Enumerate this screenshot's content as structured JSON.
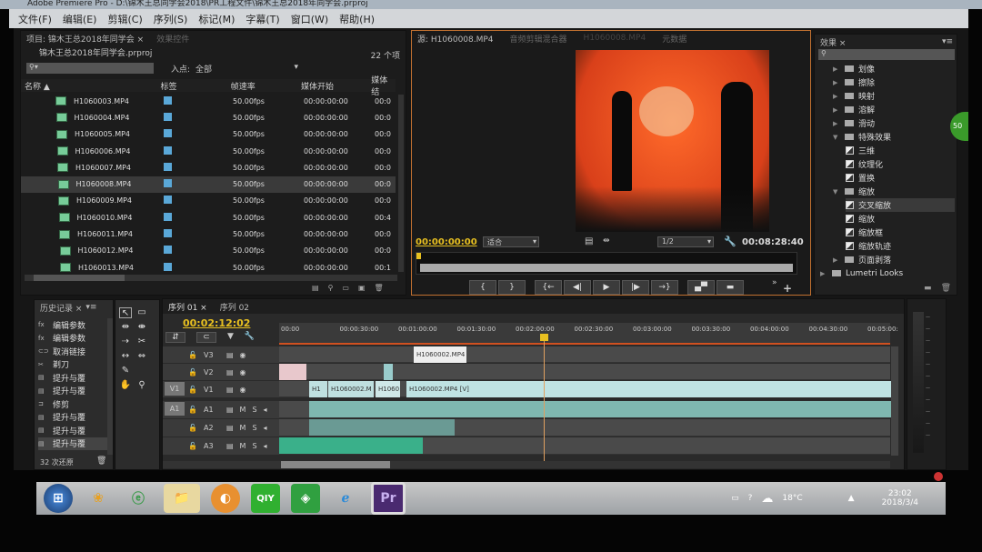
{
  "window": {
    "title": "Adobe Premiere Pro - D:\\锦木王总同学会2018\\PR工程文件\\锦木王总2018年同学会.prproj"
  },
  "menu": [
    "文件(F)",
    "编辑(E)",
    "剪辑(C)",
    "序列(S)",
    "标记(M)",
    "字幕(T)",
    "窗口(W)",
    "帮助(H)"
  ],
  "project": {
    "tab": "项目: 锦木王总2018年同学会 ×",
    "tab2": "效果控件",
    "file": "锦木王总2018年同学会.prproj",
    "count": "22 个项",
    "inpoint_label": "入点:",
    "inpoint_value": "全部",
    "columns": [
      "名称 ▲",
      "标签",
      "帧速率",
      "媒体开始",
      "媒体结"
    ],
    "rows": [
      {
        "name": "H1060003.MP4",
        "fps": "50.00fps",
        "start": "00:00:00:00",
        "end": "00:0"
      },
      {
        "name": "H1060004.MP4",
        "fps": "50.00fps",
        "start": "00:00:00:00",
        "end": "00:0"
      },
      {
        "name": "H1060005.MP4",
        "fps": "50.00fps",
        "start": "00:00:00:00",
        "end": "00:0"
      },
      {
        "name": "H1060006.MP4",
        "fps": "50.00fps",
        "start": "00:00:00:00",
        "end": "00:0"
      },
      {
        "name": "H1060007.MP4",
        "fps": "50.00fps",
        "start": "00:00:00:00",
        "end": "00:0"
      },
      {
        "name": "H1060008.MP4",
        "fps": "50.00fps",
        "start": "00:00:00:00",
        "end": "00:0"
      },
      {
        "name": "H1060009.MP4",
        "fps": "50.00fps",
        "start": "00:00:00:00",
        "end": "00:0"
      },
      {
        "name": "H1060010.MP4",
        "fps": "50.00fps",
        "start": "00:00:00:00",
        "end": "00:4"
      },
      {
        "name": "H1060011.MP4",
        "fps": "50.00fps",
        "start": "00:00:00:00",
        "end": "00:0"
      },
      {
        "name": "H1060012.MP4",
        "fps": "50.00fps",
        "start": "00:00:00:00",
        "end": "00:0"
      },
      {
        "name": "H1060013.MP4",
        "fps": "50.00fps",
        "start": "00:00:00:00",
        "end": "00:1"
      }
    ],
    "label_color": "#5aa8d8"
  },
  "source": {
    "tabs": [
      "源: H1060008.MP4",
      "音频剪辑混合器",
      "H1060008.MP4",
      "元数据"
    ],
    "timecode_in": "00:00:00:00",
    "fit": "适合",
    "resolution": "1/2",
    "duration": "00:08:28:40"
  },
  "effects": {
    "tab": "效果 ×",
    "items": [
      {
        "label": "划像",
        "type": "folder",
        "open": false,
        "indent": 0
      },
      {
        "label": "擦除",
        "type": "folder",
        "open": false,
        "indent": 0
      },
      {
        "label": "映射",
        "type": "folder",
        "open": false,
        "indent": 0
      },
      {
        "label": "溶解",
        "type": "folder",
        "open": false,
        "indent": 0
      },
      {
        "label": "滑动",
        "type": "folder",
        "open": false,
        "indent": 0
      },
      {
        "label": "特殊效果",
        "type": "folder",
        "open": true,
        "indent": 0
      },
      {
        "label": "三维",
        "type": "fx",
        "indent": 1
      },
      {
        "label": "纹理化",
        "type": "fx",
        "indent": 1
      },
      {
        "label": "置换",
        "type": "fx",
        "indent": 1
      },
      {
        "label": "缩放",
        "type": "folder",
        "open": true,
        "indent": 0
      },
      {
        "label": "交叉缩放",
        "type": "fx",
        "indent": 1,
        "selected": true
      },
      {
        "label": "缩放",
        "type": "fx",
        "indent": 1
      },
      {
        "label": "缩放框",
        "type": "fx",
        "indent": 1
      },
      {
        "label": "缩放轨迹",
        "type": "fx",
        "indent": 1
      },
      {
        "label": "页面剥落",
        "type": "folder",
        "open": false,
        "indent": 0
      },
      {
        "label": "Lumetri Looks",
        "type": "folder",
        "open": false,
        "indent": -1
      }
    ]
  },
  "history": {
    "tab": "历史记录 ×",
    "items": [
      "编辑参数",
      "编辑参数",
      "取消链接",
      "剃刀",
      "提升与覆",
      "提升与覆",
      "修剪",
      "提升与覆",
      "提升与覆",
      "提升与覆"
    ],
    "undo_count": "32 次还原"
  },
  "timeline": {
    "tabs": [
      "序列 01 ×",
      "序列 02"
    ],
    "timecode": "00:02:12:02",
    "ruler": [
      "00:00",
      "00:00:30:00",
      "00:01:00:00",
      "00:01:30:00",
      "00:02:00:00",
      "00:02:30:00",
      "00:03:00:00",
      "00:03:30:00",
      "00:04:00:00",
      "00:04:30:00",
      "00:05:00:"
    ],
    "video_tracks": [
      "V3",
      "V2",
      "V1"
    ],
    "audio_tracks": [
      "A1",
      "A2",
      "A3"
    ],
    "source_v": "V1",
    "source_a": "A1",
    "clips": {
      "v3": "H1060002.MP4",
      "v1a": "H1",
      "v1b": "H1060002.M",
      "v1c": "H1060",
      "v1d": "H1060002.MP4 [V]"
    },
    "playhead_color": "#e8c020"
  },
  "taskbar": {
    "weather": "18°C",
    "time": "23:02",
    "date": "2018/3/4",
    "pr": "Pr",
    "iqiyi": "QIY"
  }
}
